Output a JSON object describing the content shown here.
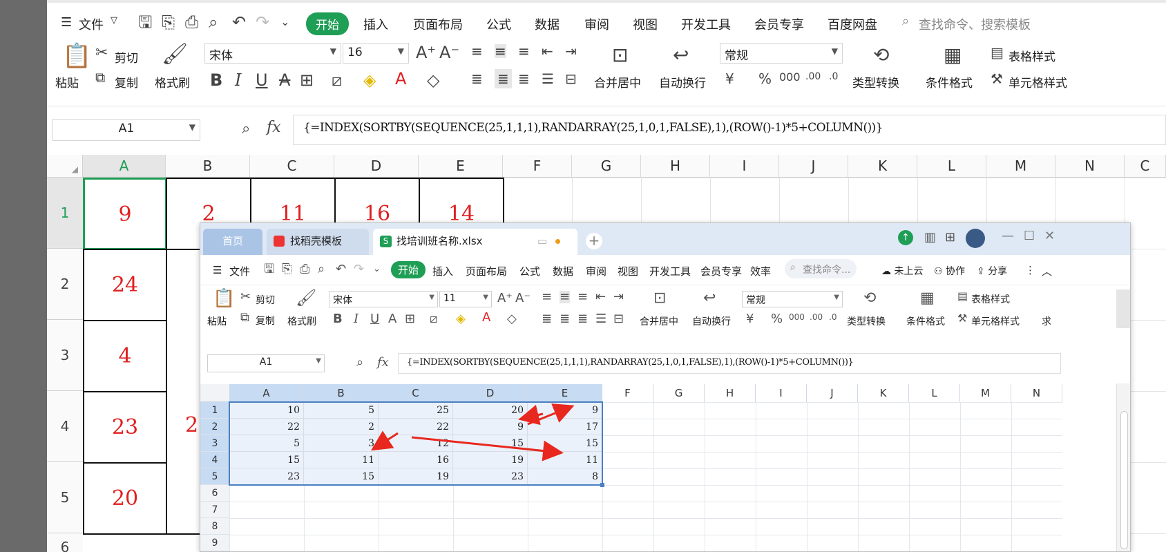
{
  "bg": {
    "menu": {
      "file": "文件",
      "tabs": [
        "开始",
        "插入",
        "页面布局",
        "公式",
        "数据",
        "审阅",
        "视图",
        "开发工具",
        "会员专享",
        "百度网盘"
      ],
      "search": "查找命令、搜索模板"
    },
    "ribbon": {
      "paste": "粘贴",
      "cut": "剪切",
      "copy": "复制",
      "format_painter": "格式刷",
      "font": "宋体",
      "size": "16",
      "merge": "合并居中",
      "wrap": "自动换行",
      "number_format": "常规",
      "convert": "类型转换",
      "cond_format": "条件格式",
      "table_style": "表格样式",
      "cell_style": "单元格样式"
    },
    "name_box": "A1",
    "formula": "{=INDEX(SORTBY(SEQUENCE(25,1,1,1),RANDARRAY(25,1,0,1,FALSE),1),(ROW()-1)*5+COLUMN())}",
    "columns": [
      "A",
      "B",
      "C",
      "D",
      "E",
      "F",
      "G",
      "H",
      "I",
      "J",
      "K",
      "L",
      "M",
      "N",
      "C"
    ],
    "rows": [
      "1",
      "2",
      "3",
      "4",
      "5",
      "6"
    ],
    "cells_row1": [
      "9",
      "2",
      "11",
      "16",
      "14"
    ],
    "cells_colA": [
      "9",
      "24",
      "4",
      "23",
      "20"
    ],
    "partial_b4": "2"
  },
  "win": {
    "tabs": {
      "home": "首页",
      "template": "找稻壳模板",
      "file": "找培训班名称.xlsx"
    },
    "menu": {
      "file": "文件",
      "tabs": [
        "开始",
        "插入",
        "页面布局",
        "公式",
        "数据",
        "审阅",
        "视图",
        "开发工具",
        "会员专享",
        "效率"
      ],
      "search": "查找命令...",
      "cloud": "未上云",
      "collab": "协作",
      "share": "分享"
    },
    "ribbon": {
      "paste": "粘贴",
      "cut": "剪切",
      "copy": "复制",
      "format_painter": "格式刷",
      "font": "宋体",
      "size": "11",
      "merge": "合并居中",
      "wrap": "自动换行",
      "number_format": "常规",
      "convert": "类型转换",
      "cond_format": "条件格式",
      "table_style": "表格样式",
      "cell_style": "单元格样式",
      "partial": "求"
    },
    "name_box": "A1",
    "formula": "{=INDEX(SORTBY(SEQUENCE(25,1,1,1),RANDARRAY(25,1,0,1,FALSE),1),(ROW()-1)*5+COLUMN())}",
    "columns": [
      "A",
      "B",
      "C",
      "D",
      "E",
      "F",
      "G",
      "H",
      "I",
      "J",
      "K",
      "L",
      "M",
      "N"
    ],
    "rows": [
      "1",
      "2",
      "3",
      "4",
      "5",
      "6",
      "7",
      "8",
      "9"
    ],
    "grid": [
      [
        "10",
        "5",
        "25",
        "20",
        "9"
      ],
      [
        "22",
        "2",
        "22",
        "9",
        "17"
      ],
      [
        "5",
        "3",
        "12",
        "15",
        "15"
      ],
      [
        "15",
        "11",
        "16",
        "19",
        "11"
      ],
      [
        "23",
        "15",
        "19",
        "23",
        "8"
      ]
    ]
  },
  "colors": {
    "accent": "#1f9e55",
    "red": "#e02020",
    "selection": "#c7dbf3"
  }
}
